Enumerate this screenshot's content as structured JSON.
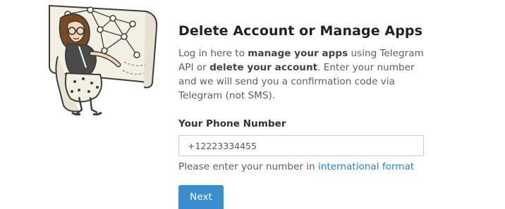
{
  "header": {
    "title": "Delete Account or Manage Apps"
  },
  "description": {
    "part1": "Log in here to ",
    "bold1": "manage your apps",
    "part2": " using Telegram API or ",
    "bold2": "delete your account",
    "part3": ". Enter your number and we will send you a confirmation code via Telegram (not SMS)."
  },
  "form": {
    "phone_label": "Your Phone Number",
    "phone_value": "+12223334455",
    "hint_text": "Please enter your number in ",
    "hint_link": "international format",
    "next_label": "Next"
  },
  "colors": {
    "accent": "#3a8ece",
    "link": "#2481cc"
  },
  "icons": {
    "illustration": "woman-at-network-board-illustration"
  }
}
